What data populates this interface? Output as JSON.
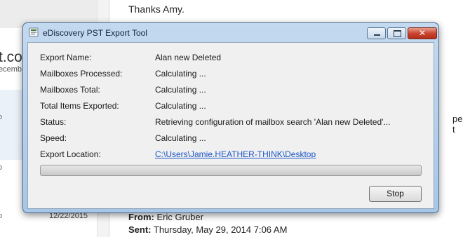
{
  "background": {
    "email_fragment": "t.con",
    "month_fragment": "ecemb",
    "arrow_glyph": "o",
    "list_date": "12/22/2015",
    "reading_thanks": "Thanks Amy.",
    "reading_right_fragment": "pen t",
    "from_label": "From:",
    "from_value": "Eric Gruber",
    "sent_label": "Sent:",
    "sent_value": "Thursday, May 29, 2014 7:06 AM"
  },
  "dialog": {
    "title": "eDiscovery PST Export Tool",
    "icons": {
      "app": "pst-export-app-icon",
      "minimize": "minimize-icon",
      "maximize": "maximize-icon",
      "close": "close-icon"
    },
    "close_glyph": "✕",
    "fields": {
      "export_name": {
        "label": "Export Name:",
        "value": "Alan new Deleted"
      },
      "mailboxes_processed": {
        "label": "Mailboxes Processed:",
        "value": "Calculating ..."
      },
      "mailboxes_total": {
        "label": "Mailboxes Total:",
        "value": "Calculating ..."
      },
      "total_items": {
        "label": "Total Items Exported:",
        "value": "Calculating ..."
      },
      "status": {
        "label": "Status:",
        "value": "Retrieving configuration of mailbox search 'Alan new Deleted'..."
      },
      "speed": {
        "label": "Speed:",
        "value": "Calculating ..."
      },
      "export_location": {
        "label": "Export Location:",
        "value": "C:\\Users\\Jamie.HEATHER-THINK\\Desktop"
      }
    },
    "progress_fraction": 0,
    "stop_label": "Stop"
  }
}
